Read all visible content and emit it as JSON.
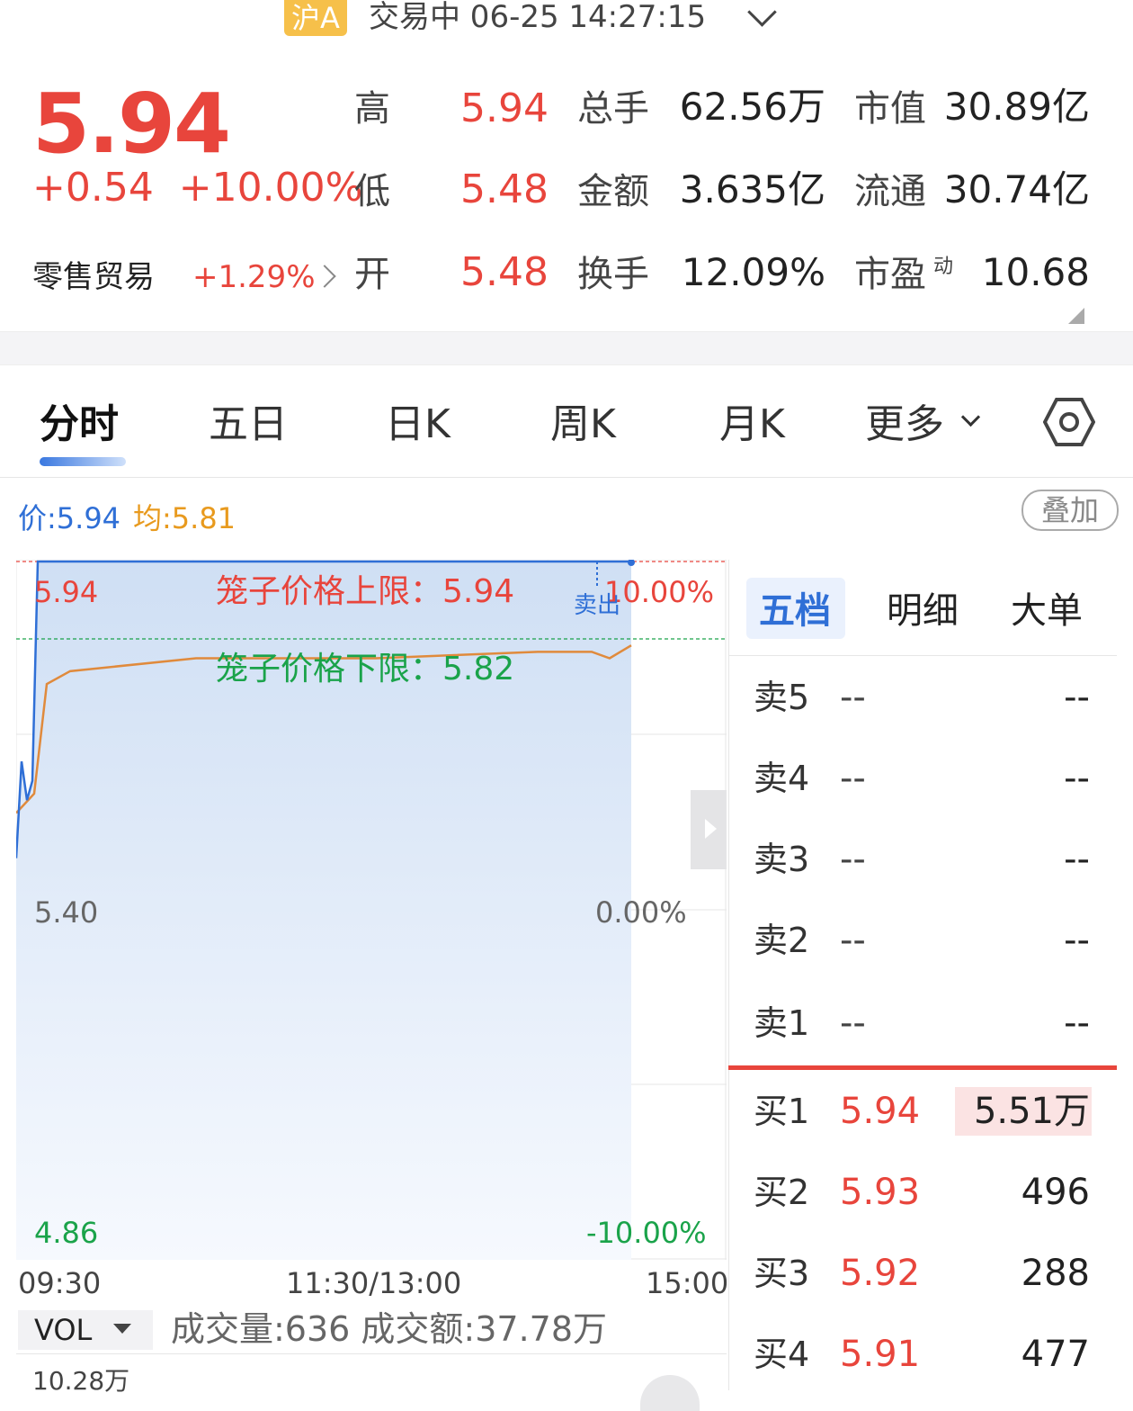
{
  "header": {
    "market_badge": "沪A",
    "status": "交易中 06-25 14:27:15",
    "price": "5.94",
    "change": "+0.54  +10.00%",
    "sector_name": "零售贸易",
    "sector_change": "+1.29%"
  },
  "stats": {
    "high_label": "高",
    "high": "5.94",
    "low_label": "低",
    "low": "5.48",
    "open_label": "开",
    "open": "5.48",
    "volume_label": "总手",
    "volume": "62.56万",
    "amount_label": "金额",
    "amount": "3.635亿",
    "turnover_label": "换手",
    "turnover": "12.09%",
    "mktcap_label": "市值",
    "mktcap": "30.89亿",
    "float_label": "流通",
    "float": "30.74亿",
    "pe_label": "市盈",
    "pe_sup": "动",
    "pe": "10.68"
  },
  "tabs": [
    "分时",
    "五日",
    "日K",
    "周K",
    "月K",
    "更多"
  ],
  "chart_info": {
    "price_label": "价:5.94",
    "avg_label": "均:5.81",
    "overlay_button": "叠加",
    "y_top": "5.94",
    "y_mid": "5.40",
    "y_bottom": "4.86",
    "pct_top": "10.00%",
    "pct_mid": "0.00%",
    "pct_bottom": "-10.00%",
    "cage_upper": "笼子价格上限：5.94",
    "cage_lower": "笼子价格下限：5.82",
    "sell_marker": "卖出",
    "time_start": "09:30",
    "time_mid": "11:30/13:00",
    "time_end": "15:00",
    "vol_selector": "VOL",
    "vol_text": "成交量:636 成交额:37.78万",
    "vol_scale": "10.28万",
    "colors": {
      "price_line": "#2f6fd6",
      "avg_line": "#e08a3c",
      "upper": "#e8453c",
      "lower": "#1aa34a"
    }
  },
  "chart_data": {
    "type": "line",
    "ylim": [
      4.86,
      5.94
    ],
    "series": [
      {
        "name": "价",
        "values": [
          5.48,
          5.63,
          5.57,
          5.6,
          5.94,
          5.94,
          5.94,
          5.94,
          5.94,
          5.94
        ]
      },
      {
        "name": "均",
        "values": [
          5.55,
          5.58,
          5.75,
          5.77,
          5.79,
          5.79,
          5.8,
          5.8,
          5.79,
          5.81
        ]
      }
    ]
  },
  "orderbook": {
    "tabs": [
      "五档",
      "明细",
      "大单"
    ],
    "asks": [
      {
        "label": "卖5",
        "price": "--",
        "vol": "--"
      },
      {
        "label": "卖4",
        "price": "--",
        "vol": "--"
      },
      {
        "label": "卖3",
        "price": "--",
        "vol": "--"
      },
      {
        "label": "卖2",
        "price": "--",
        "vol": "--"
      },
      {
        "label": "卖1",
        "price": "--",
        "vol": "--"
      }
    ],
    "bids": [
      {
        "label": "买1",
        "price": "5.94",
        "vol": "5.51万"
      },
      {
        "label": "买2",
        "price": "5.93",
        "vol": "496"
      },
      {
        "label": "买3",
        "price": "5.92",
        "vol": "288"
      },
      {
        "label": "买4",
        "price": "5.91",
        "vol": "477"
      }
    ]
  }
}
